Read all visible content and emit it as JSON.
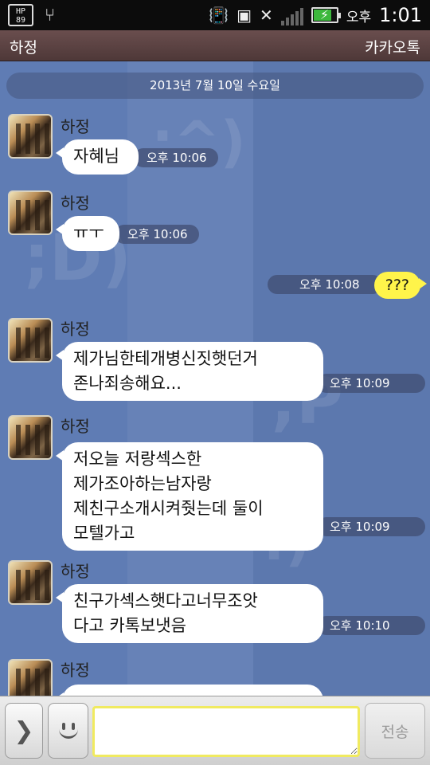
{
  "status_bar": {
    "hp_label": "HP\n89",
    "usb_icon": "usb-icon",
    "ampm": "오후",
    "time": "1:01"
  },
  "title_bar": {
    "chat_name": "하정",
    "app_name": "카카오톡"
  },
  "chat": {
    "date_divider": "2013년 7월 10일 수요일",
    "messages": [
      {
        "sender": "하정",
        "text": "자혜님",
        "time": "오후 10:06"
      },
      {
        "sender": "하정",
        "text": "ㅠㅜ",
        "time": "오후 10:06"
      },
      {
        "sender": "me",
        "text": "???",
        "time": "오후 10:08"
      },
      {
        "sender": "하정",
        "text": "제가님한테개병신짓햇던거\n존나죄송해요...",
        "time": "오후 10:09"
      },
      {
        "sender": "하정",
        "text": "저오늘 저랑섹스한\n제가조아하는남자랑\n제친구소개시켜줫는데 둘이\n모텔가고",
        "time": "오후 10:09"
      },
      {
        "sender": "하정",
        "text": "친구가섹스햇다고너무조앗\n다고 카톡보냇음",
        "time": "오후 10:10"
      },
      {
        "sender": "하정",
        "text": "",
        "time": ""
      }
    ]
  },
  "input_bar": {
    "send_label": "전송",
    "message_value": ""
  },
  "colors": {
    "chat_background": "#5f7cb4",
    "my_bubble": "#fff44a",
    "title_bar": "#5a4242"
  }
}
